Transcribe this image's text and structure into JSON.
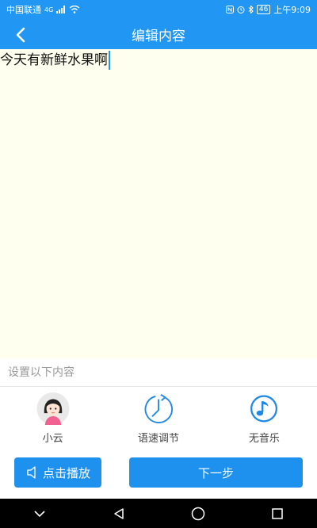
{
  "status_bar": {
    "carrier": "中国联通",
    "network": "4G",
    "battery": "46",
    "time": "上午9:09"
  },
  "app_bar": {
    "title": "编辑内容",
    "back_icon": "chevron-left-icon"
  },
  "editor": {
    "text": "今天有新鲜水果啊"
  },
  "settings": {
    "label": "设置以下内容",
    "options": [
      {
        "label": "小云",
        "icon": "avatar-girl-icon"
      },
      {
        "label": "语速调节",
        "icon": "speed-dial-icon"
      },
      {
        "label": "无音乐",
        "icon": "music-note-icon"
      }
    ]
  },
  "actions": {
    "play_label": "点击播放",
    "next_label": "下一步"
  },
  "colors": {
    "primary": "#2196F3",
    "editor_bg": "#FFFFF0",
    "nav_bg": "#000000"
  }
}
